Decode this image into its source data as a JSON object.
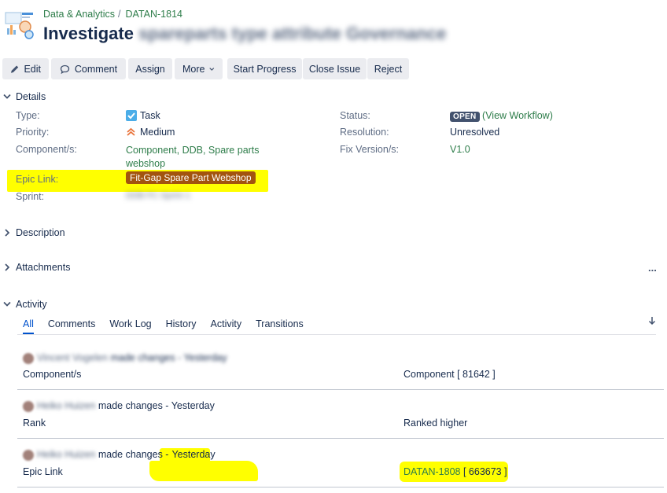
{
  "header": {
    "project": "Data & Analytics",
    "separator": "/",
    "issue_key": "DATAN-1814",
    "title_visible": "Investigate",
    "title_blurred": "spareparts type attribute Governance"
  },
  "toolbar": {
    "edit": "Edit",
    "comment": "Comment",
    "assign": "Assign",
    "more": "More",
    "start_progress": "Start Progress",
    "close_issue": "Close Issue",
    "reject": "Reject"
  },
  "details": {
    "heading": "Details",
    "type_label": "Type:",
    "type_value": "Task",
    "priority_label": "Priority:",
    "priority_value": "Medium",
    "components_label": "Component/s:",
    "components_line1": "Component, DDB, Spare parts",
    "components_line2": "webshop",
    "epic_label": "Epic Link:",
    "epic_value": "Fit-Gap Spare Part Webshop",
    "sprint_label": "Sprint:",
    "sprint_value_blurred": "DDB FC Sprint 1",
    "status_label": "Status:",
    "status_value": "OPEN",
    "workflow_link": "(View Workflow)",
    "resolution_label": "Resolution:",
    "resolution_value": "Unresolved",
    "fix_label": "Fix Version/s:",
    "fix_value": "V1.0"
  },
  "sections": {
    "description": "Description",
    "attachments": "Attachments",
    "attachments_more": "...",
    "activity": "Activity"
  },
  "activity": {
    "tabs": [
      "All",
      "Comments",
      "Work Log",
      "History",
      "Activity",
      "Transitions"
    ],
    "active_tab": "All",
    "sort_icon": "arrow-down-icon",
    "entries": [
      {
        "user_blurred": "Vincent Vogelen",
        "action_blurred": "made changes - Yesterday",
        "field": "Component/s",
        "new_value": "Component [ 81642 ]"
      },
      {
        "user_blurred": "Heiko Huizen",
        "action": "made changes - Yesterday",
        "field": "Rank",
        "new_value": "Ranked higher"
      },
      {
        "user_blurred": "Heiko Huizen",
        "action_prefix": "made changes -",
        "action_time": "Yesterday",
        "field": "Epic Link",
        "new_value_link": "DATAN-1808",
        "new_value_id": "[ 663673 ]"
      }
    ]
  },
  "colors": {
    "link_green": "#2e7d4a",
    "epic_brown": "#a2540f",
    "highlight_yellow": "#ffff00",
    "status_grey": "#42526e",
    "active_tab_blue": "#0052cc"
  }
}
